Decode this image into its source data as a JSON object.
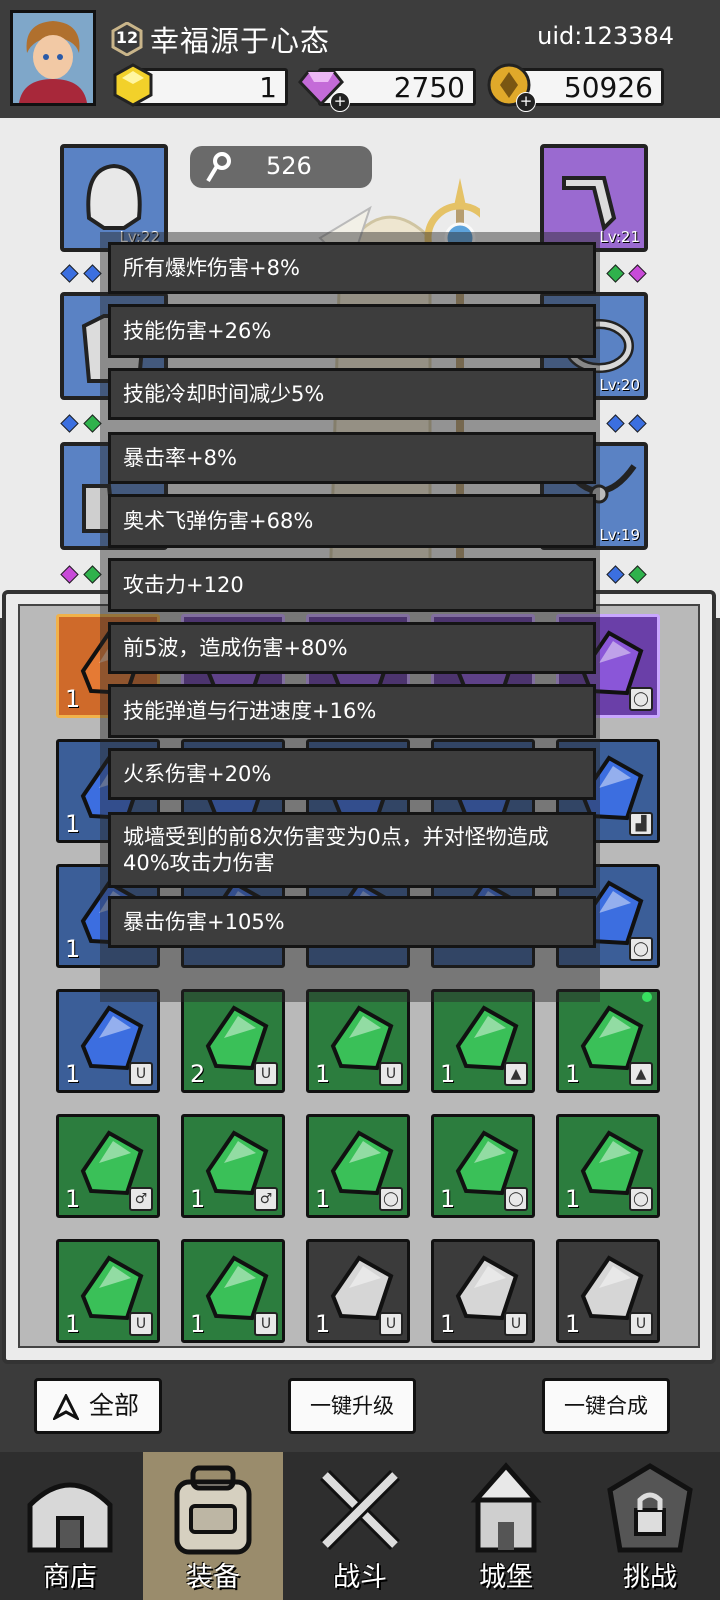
{
  "header": {
    "player_level": "12",
    "player_name": "幸福源于心态",
    "uid": "uid:123384",
    "currencies": [
      {
        "name": "energy-crystal",
        "value": "1",
        "color": "#f2d12a"
      },
      {
        "name": "diamond",
        "value": "2750",
        "color": "#c46bd8"
      },
      {
        "name": "gold-coin",
        "value": "50926",
        "color": "#e0a92a"
      }
    ]
  },
  "stage": {
    "power": "526",
    "equipment_slots": [
      {
        "side": "left",
        "label": "Lv:22",
        "item": "hood-icon",
        "color": "#5a82c4"
      },
      {
        "side": "right",
        "label": "Lv:21",
        "item": "pipe-icon",
        "color": "#9a6ad0"
      },
      {
        "side": "right",
        "label": "Lv:20",
        "item": "ring-icon",
        "color": "#5a82c4"
      },
      {
        "side": "right",
        "label": "Lv:19",
        "item": "necklace-icon",
        "color": "#5a82c4"
      }
    ]
  },
  "tooltip": {
    "lines": [
      "所有爆炸伤害+8%",
      "技能伤害+26%",
      "技能冷却时间减少5%",
      "暴击率+8%",
      "奥术飞弹伤害+68%",
      "攻击力+120",
      "前5波，造成伤害+80%",
      "技能弹道与行进速度+16%",
      "火系伤害+20%",
      "城墙受到的前8次伤害变为0点，并对怪物造成40%攻击力伤害",
      "暴击伤害+105%"
    ]
  },
  "inventory": {
    "rows": [
      [
        {
          "color": "orange",
          "count": "1",
          "tag": ""
        },
        {
          "color": "violet",
          "count": "",
          "tag": ""
        },
        {
          "color": "violet",
          "count": "",
          "tag": ""
        },
        {
          "color": "violet",
          "count": "",
          "tag": ""
        },
        {
          "color": "violet",
          "count": "",
          "tag": "ring-icon"
        }
      ],
      [
        {
          "color": "blue",
          "count": "1",
          "tag": ""
        },
        {
          "color": "blue",
          "count": "",
          "tag": ""
        },
        {
          "color": "blue",
          "count": "",
          "tag": ""
        },
        {
          "color": "blue",
          "count": "",
          "tag": ""
        },
        {
          "color": "blue",
          "count": "",
          "tag": "boot-icon"
        }
      ],
      [
        {
          "color": "blue",
          "count": "1",
          "tag": ""
        },
        {
          "color": "blue",
          "count": "",
          "tag": ""
        },
        {
          "color": "blue",
          "count": "",
          "tag": ""
        },
        {
          "color": "blue",
          "count": "",
          "tag": ""
        },
        {
          "color": "blue",
          "count": "",
          "tag": "ring-icon"
        }
      ],
      [
        {
          "color": "blue",
          "count": "1",
          "tag": "necklace-icon"
        },
        {
          "color": "green",
          "count": "2",
          "tag": "necklace-icon"
        },
        {
          "color": "green",
          "count": "1",
          "tag": "necklace-icon"
        },
        {
          "color": "green",
          "count": "1",
          "tag": "armor-icon"
        },
        {
          "color": "green",
          "count": "1",
          "tag": "armor-icon"
        }
      ],
      [
        {
          "color": "green",
          "count": "1",
          "tag": "staff-icon"
        },
        {
          "color": "green",
          "count": "1",
          "tag": "staff-icon"
        },
        {
          "color": "green",
          "count": "1",
          "tag": "ring-icon"
        },
        {
          "color": "green",
          "count": "1",
          "tag": "ring-icon"
        },
        {
          "color": "green",
          "count": "1",
          "tag": "ring-icon"
        }
      ],
      [
        {
          "color": "green",
          "count": "1",
          "tag": "necklace-icon"
        },
        {
          "color": "green",
          "count": "1",
          "tag": "necklace-icon"
        },
        {
          "color": "gray",
          "count": "1",
          "tag": "necklace-icon"
        },
        {
          "color": "gray",
          "count": "1",
          "tag": "necklace-icon"
        },
        {
          "color": "gray",
          "count": "1",
          "tag": "necklace-icon"
        }
      ]
    ]
  },
  "actions": {
    "filter_all": "全部",
    "upgrade_all": "一键升级",
    "merge_all": "一键合成"
  },
  "nav": [
    {
      "label": "商店",
      "icon": "shop-icon"
    },
    {
      "label": "装备",
      "icon": "backpack-icon"
    },
    {
      "label": "战斗",
      "icon": "crossed-swords-icon"
    },
    {
      "label": "城堡",
      "icon": "castle-icon"
    },
    {
      "label": "挑战",
      "icon": "locked-challenge-icon"
    }
  ],
  "colors": {
    "header_bg": "#3d3d3d",
    "tooltip_row": "#3d3d3d",
    "active_tab": "#9a8c6c"
  }
}
